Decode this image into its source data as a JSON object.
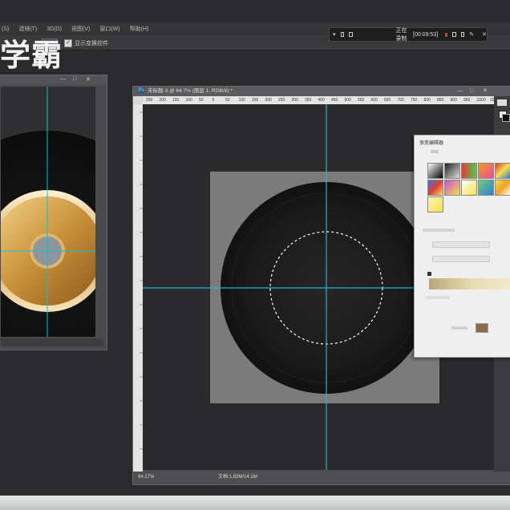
{
  "app": {
    "watermark": "学霸"
  },
  "menubar": {
    "items": [
      "(S)",
      "滤镜(T)",
      "3D(D)",
      "视图(V)",
      "窗口(W)",
      "帮助(H)"
    ]
  },
  "options": {
    "checkbox_label": "显示变换控件",
    "checked": true
  },
  "recorder": {
    "status": "正在录制",
    "time": "[00:09:53]"
  },
  "doc_window": {
    "title": "未标题-3 @ 64.7% (图层 1, RGB/8) *",
    "ruler_ticks": [
      "250",
      "200",
      "150",
      "100",
      "50",
      "0",
      "50",
      "100",
      "150",
      "200",
      "250",
      "300",
      "350",
      "400",
      "450",
      "500",
      "550",
      "600",
      "650",
      "700",
      "750",
      "800",
      "850",
      "900",
      "950",
      "1000",
      "1050",
      "1100",
      "1150"
    ],
    "zoom": "64.17%",
    "doc_size": "文档:1.82M/14.1M"
  },
  "gradient_dialog": {
    "title": "渐变编辑器",
    "swatch_colors": [
      "#b8b8b8",
      "#111111",
      "#e23b3b",
      "#f0a020",
      "#2e7de0",
      "#6fd06f",
      "#f4e04a",
      "#c84fd8"
    ],
    "stop_color": "#8b6b47"
  },
  "colors": {
    "guide": "#19b9d8",
    "app_bg": "#2b2a2c",
    "doc_bg": "#7b7b7b",
    "gold_light": "#f2c468",
    "gold_dark": "#9c6620"
  }
}
